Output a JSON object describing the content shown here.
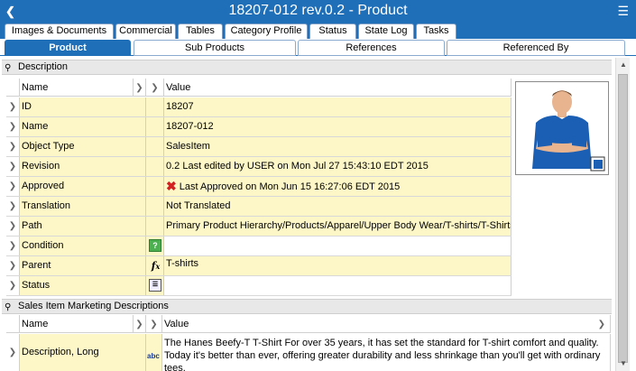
{
  "window": {
    "title": "18207-012 rev.0.2 - Product"
  },
  "tabs_row1": [
    "Images & Documents",
    "Commercial",
    "Tables",
    "Category Profile",
    "Status",
    "State Log",
    "Tasks"
  ],
  "tabs_row2": [
    "Product",
    "Sub Products",
    "References",
    "Referenced By"
  ],
  "description": {
    "header": "Description",
    "col_name": "Name",
    "col_value": "Value",
    "rows": [
      {
        "name": "ID",
        "value": "18207"
      },
      {
        "name": "Name",
        "value": "18207-012"
      },
      {
        "name": "Object Type",
        "value": "SalesItem"
      },
      {
        "name": "Revision",
        "value": "0.2 Last edited by USER on Mon Jul 27 15:43:10 EDT 2015"
      },
      {
        "name": "Approved",
        "value": "Last Approved on Mon Jun 15 16:27:06 EDT 2015"
      },
      {
        "name": "Translation",
        "value": "Not Translated"
      },
      {
        "name": "Path",
        "value": "Primary Product Hierarchy/Products/Apparel/Upper Body Wear/T-shirts/T-Shirts"
      },
      {
        "name": "Condition",
        "value": ""
      },
      {
        "name": "Parent",
        "value": "T-shirts"
      },
      {
        "name": "Status",
        "value": ""
      }
    ]
  },
  "marketing": {
    "header": "Sales Item Marketing Descriptions",
    "col_name": "Name",
    "col_value": "Value",
    "row_name": "Description, Long",
    "row_value": "The Hanes Beefy-T T-Shirt For over 35 years, it has set the standard for T-shirt comfort and quality. Today it's better than ever, offering greater durability and less shrinkage than you'll get with ordinary tees."
  },
  "icons": {
    "title": "folder-icon",
    "pin": "pin-icon",
    "approved": "red-x-icon",
    "condition": "green-question-icon",
    "parent": "fx-icon",
    "status": "list-icon",
    "description": "abc-icon"
  },
  "colors": {
    "accent": "#1e6eb8",
    "field_bg": "#fdf7c8"
  }
}
